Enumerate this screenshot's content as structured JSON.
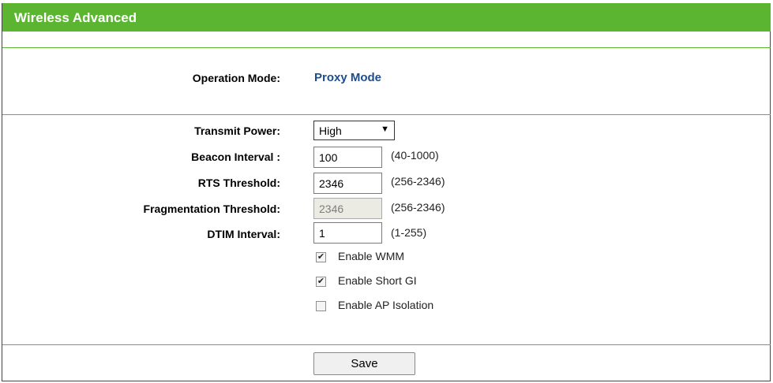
{
  "header": {
    "title": "Wireless Advanced"
  },
  "operation_mode": {
    "label": "Operation Mode:",
    "value": "Proxy Mode"
  },
  "transmit_power": {
    "label": "Transmit Power:",
    "selected": "High"
  },
  "beacon_interval": {
    "label": "Beacon Interval :",
    "value": "100",
    "range": "(40-1000)"
  },
  "rts_threshold": {
    "label": "RTS Threshold:",
    "value": "2346",
    "range": "(256-2346)"
  },
  "fragmentation_threshold": {
    "label": "Fragmentation Threshold:",
    "value": "2346",
    "range": "(256-2346)"
  },
  "dtim_interval": {
    "label": "DTIM Interval:",
    "value": "1",
    "range": "(1-255)"
  },
  "checkboxes": {
    "wmm": {
      "label": "Enable WMM",
      "checked": true
    },
    "short_gi": {
      "label": "Enable Short GI",
      "checked": true
    },
    "ap_isolation": {
      "label": "Enable AP Isolation",
      "checked": false
    }
  },
  "save_label": "Save",
  "colors": {
    "header_green": "#5cb531",
    "mode_blue": "#1e4d8c"
  }
}
